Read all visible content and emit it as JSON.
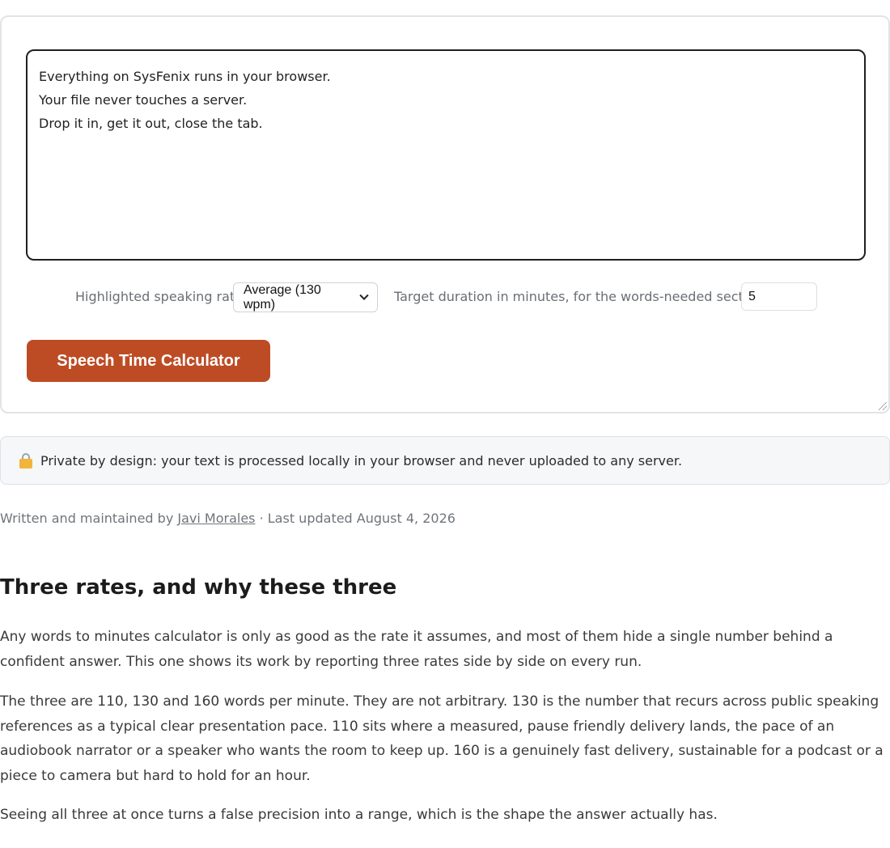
{
  "tool": {
    "text_input": {
      "value": "Everything on SysFenix runs in your browser.\nYour file never touches a server.\nDrop it in, get it out, close the tab."
    },
    "rate": {
      "label": "Highlighted speaking rate",
      "selected": "Average (130 wpm)"
    },
    "duration": {
      "label": "Target duration in minutes, for the words-needed section",
      "value": "5"
    },
    "calculate_label": "Speech Time Calculator"
  },
  "privacy_note": {
    "icon": "lock-icon",
    "text": "Private by design: your text is processed locally in your browser and never uploaded to any server."
  },
  "byline": {
    "prefix": "Written and maintained by ",
    "author": "Javi Morales",
    "separator": " · ",
    "updated": "Last updated August 4, 2026"
  },
  "article": {
    "heading": "Three rates, and why these three",
    "paragraphs": [
      "Any words to minutes calculator is only as good as the rate it assumes, and most of them hide a single number behind a confident answer. This one shows its work by reporting three rates side by side on every run.",
      "The three are 110, 130 and 160 words per minute. They are not arbitrary. 130 is the number that recurs across public speaking references as a typical clear presentation pace. 110 sits where a measured, pause friendly delivery lands, the pace of an audiobook narrator or a speaker who wants the room to keep up. 160 is a genuinely fast delivery, sustainable for a podcast or a piece to camera but hard to hold for an hour.",
      "Seeing all three at once turns a false precision into a range, which is the shape the answer actually has."
    ]
  }
}
